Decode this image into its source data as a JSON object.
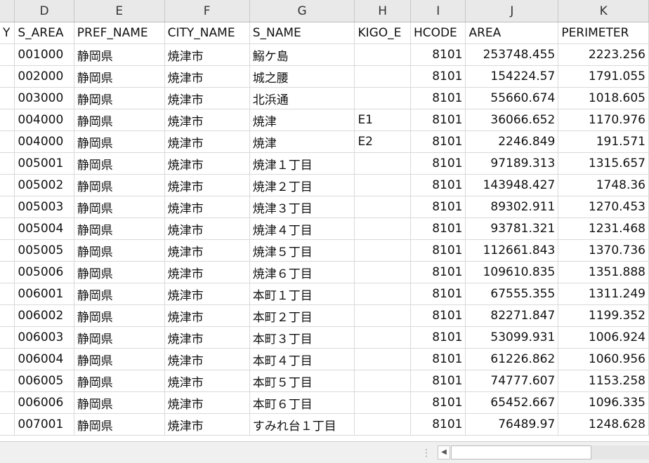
{
  "columns": [
    {
      "letter": "",
      "header": "Y"
    },
    {
      "letter": "D",
      "header": "S_AREA"
    },
    {
      "letter": "E",
      "header": "PREF_NAME"
    },
    {
      "letter": "F",
      "header": "CITY_NAME"
    },
    {
      "letter": "G",
      "header": "S_NAME"
    },
    {
      "letter": "H",
      "header": "KIGO_E"
    },
    {
      "letter": "I",
      "header": "HCODE"
    },
    {
      "letter": "J",
      "header": "AREA"
    },
    {
      "letter": "K",
      "header": "PERIMETER"
    }
  ],
  "rows": [
    [
      "",
      "001000",
      "静岡県",
      "焼津市",
      "鰯ケ島",
      "",
      "8101",
      "253748.455",
      "2223.256"
    ],
    [
      "",
      "002000",
      "静岡県",
      "焼津市",
      "城之腰",
      "",
      "8101",
      "154224.57",
      "1791.055"
    ],
    [
      "",
      "003000",
      "静岡県",
      "焼津市",
      "北浜通",
      "",
      "8101",
      "55660.674",
      "1018.605"
    ],
    [
      "",
      "004000",
      "静岡県",
      "焼津市",
      "焼津",
      "E1",
      "8101",
      "36066.652",
      "1170.976"
    ],
    [
      "",
      "004000",
      "静岡県",
      "焼津市",
      "焼津",
      "E2",
      "8101",
      "2246.849",
      "191.571"
    ],
    [
      "",
      "005001",
      "静岡県",
      "焼津市",
      "焼津１丁目",
      "",
      "8101",
      "97189.313",
      "1315.657"
    ],
    [
      "",
      "005002",
      "静岡県",
      "焼津市",
      "焼津２丁目",
      "",
      "8101",
      "143948.427",
      "1748.36"
    ],
    [
      "",
      "005003",
      "静岡県",
      "焼津市",
      "焼津３丁目",
      "",
      "8101",
      "89302.911",
      "1270.453"
    ],
    [
      "",
      "005004",
      "静岡県",
      "焼津市",
      "焼津４丁目",
      "",
      "8101",
      "93781.321",
      "1231.468"
    ],
    [
      "",
      "005005",
      "静岡県",
      "焼津市",
      "焼津５丁目",
      "",
      "8101",
      "112661.843",
      "1370.736"
    ],
    [
      "",
      "005006",
      "静岡県",
      "焼津市",
      "焼津６丁目",
      "",
      "8101",
      "109610.835",
      "1351.888"
    ],
    [
      "",
      "006001",
      "静岡県",
      "焼津市",
      "本町１丁目",
      "",
      "8101",
      "67555.355",
      "1311.249"
    ],
    [
      "",
      "006002",
      "静岡県",
      "焼津市",
      "本町２丁目",
      "",
      "8101",
      "82271.847",
      "1199.352"
    ],
    [
      "",
      "006003",
      "静岡県",
      "焼津市",
      "本町３丁目",
      "",
      "8101",
      "53099.931",
      "1006.924"
    ],
    [
      "",
      "006004",
      "静岡県",
      "焼津市",
      "本町４丁目",
      "",
      "8101",
      "61226.862",
      "1060.956"
    ],
    [
      "",
      "006005",
      "静岡県",
      "焼津市",
      "本町５丁目",
      "",
      "8101",
      "74777.607",
      "1153.258"
    ],
    [
      "",
      "006006",
      "静岡県",
      "焼津市",
      "本町６丁目",
      "",
      "8101",
      "65452.667",
      "1096.335"
    ],
    [
      "",
      "007001",
      "静岡県",
      "焼津市",
      "すみれ台１丁目",
      "",
      "8101",
      "76489.97",
      "1248.628"
    ]
  ],
  "numeric_columns": [
    6,
    7,
    8
  ],
  "scrollbar": {
    "left_arrow_icon": "◀",
    "split_handle_icon": "⋮"
  }
}
